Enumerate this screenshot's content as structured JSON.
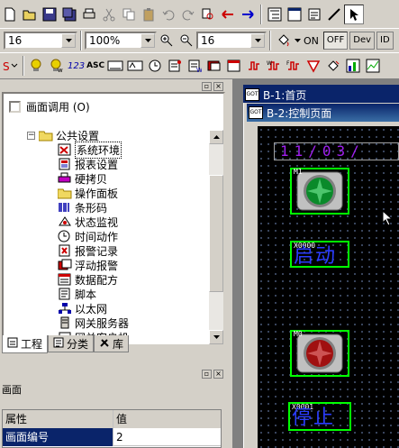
{
  "toolbar2": {
    "font_size": "16",
    "zoom": "100%",
    "font_size2": "16",
    "on_label": "ON",
    "off_label": "OFF",
    "dev_label": "Dev",
    "id_label": "ID"
  },
  "toolbar3": {
    "label_123": "123",
    "label_asc": "ASC"
  },
  "left_panel": {
    "screen_call_label": "画面调用 (O)",
    "tree": {
      "folder": "公共设置",
      "items": [
        "系统环境",
        "报表设置",
        "硬拷贝",
        "操作面板",
        "条形码",
        "状态监视",
        "时间动作",
        "报警记录",
        "浮动报警",
        "数据配方",
        "脚本",
        "以太网",
        "网关服务器",
        "网关客户机"
      ]
    },
    "tabs": [
      "工程",
      "分类",
      "库"
    ]
  },
  "properties": {
    "title": "画面",
    "col_attr": "属性",
    "col_value": "值",
    "row_name": "画面编号",
    "row_value": "2"
  },
  "mdi": {
    "window1_title": "B-1:首页",
    "window2_title": "B-2:控制页面",
    "date_text": "11/03/",
    "lamp1_tag": "M1",
    "lamp2_tag": "M0",
    "text1_tag": "X0000",
    "text1_label": "启动",
    "text2_tag": "X0001",
    "text2_label": "停止"
  },
  "colors": {
    "title_active": "#0a246a",
    "canvas_bg": "#000000",
    "green_frame": "#00ff00",
    "date_color": "#a020f0",
    "text_blue": "#2a3cff"
  }
}
